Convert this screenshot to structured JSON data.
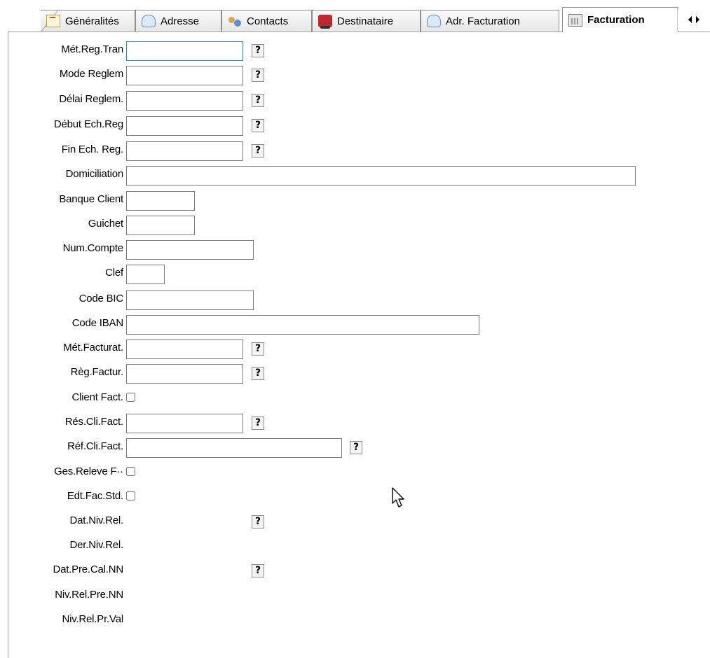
{
  "tabs": [
    {
      "label": "Généralités",
      "icon": "document-icon"
    },
    {
      "label": "Adresse",
      "icon": "envelope-icon"
    },
    {
      "label": "Contacts",
      "icon": "people-icon"
    },
    {
      "label": "Destinataire",
      "icon": "truck-icon"
    },
    {
      "label": "Adr. Facturation",
      "icon": "envelope-icon"
    },
    {
      "label": "Facturation",
      "icon": "calculator-icon",
      "active": true
    }
  ],
  "form": {
    "met_reg_tran": {
      "label": "Mét.Reg.Tran",
      "value": ""
    },
    "mode_reglem": {
      "label": "Mode Reglem",
      "value": ""
    },
    "delai_reglem": {
      "label": "Délai Reglem.",
      "value": ""
    },
    "debut_ech_reg": {
      "label": "Début Ech.Reg",
      "value": ""
    },
    "fin_ech_reg": {
      "label": "Fin Ech. Reg.",
      "value": ""
    },
    "domiciliation": {
      "label": "Domiciliation",
      "value": ""
    },
    "banque_client": {
      "label": "Banque Client",
      "value": ""
    },
    "guichet": {
      "label": "Guichet",
      "value": ""
    },
    "num_compte": {
      "label": "Num.Compte",
      "value": ""
    },
    "clef": {
      "label": "Clef",
      "value": ""
    },
    "code_bic": {
      "label": "Code BIC",
      "value": ""
    },
    "code_iban": {
      "label": "Code IBAN",
      "value": ""
    },
    "met_facturat": {
      "label": "Mét.Facturat.",
      "value": ""
    },
    "reg_factur": {
      "label": "Règ.Factur.",
      "value": ""
    },
    "client_fact": {
      "label": "Client Fact.",
      "checked": false
    },
    "res_cli_fact": {
      "label": "Rés.Cli.Fact.",
      "value": ""
    },
    "ref_cli_fact": {
      "label": "Réf.Cli.Fact.",
      "value": ""
    },
    "ges_releve_f": {
      "label": "Ges.Releve F··",
      "checked": false
    },
    "edt_fac_std": {
      "label": "Edt.Fac.Std.",
      "checked": false
    },
    "dat_niv_rel": {
      "label": "Dat.Niv.Rel."
    },
    "der_niv_rel": {
      "label": "Der.Niv.Rel."
    },
    "dat_pre_cal_nn": {
      "label": "Dat.Pre.Cal.NN"
    },
    "niv_rel_pre_nn": {
      "label": "Niv.Rel.Pre.NN"
    },
    "niv_rel_pr_val": {
      "label": "Niv.Rel.Pr.Val"
    }
  },
  "help_button_label": "?",
  "colors": {
    "focus_border": "#3c7fb1",
    "field_border": "#7a7a7a",
    "tab_border": "#8f8f8f"
  }
}
